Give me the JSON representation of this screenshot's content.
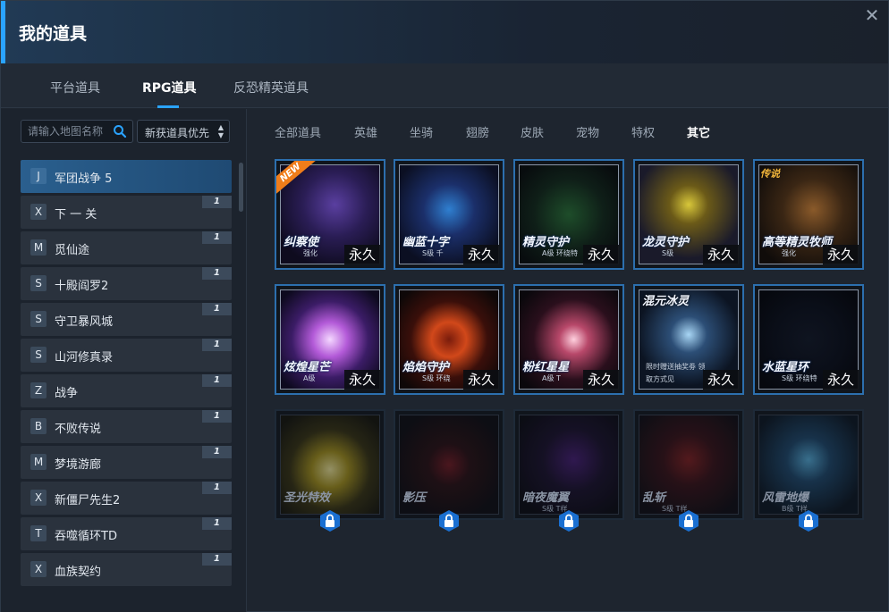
{
  "window": {
    "title": "我的道具",
    "close_icon": "close-icon"
  },
  "tabs": [
    {
      "label": "平台道具",
      "active": false
    },
    {
      "label": "RPG道具",
      "active": true
    },
    {
      "label": "反恐精英道具",
      "active": false
    }
  ],
  "sidebar": {
    "search": {
      "placeholder": "请输入地图名称",
      "value": "",
      "icon": "search-icon"
    },
    "sort": {
      "value": "新获道具优先",
      "icon": "sort-arrows-icon"
    },
    "items": [
      {
        "letter": "J",
        "name": "军团战争 5",
        "count": "",
        "active": true
      },
      {
        "letter": "X",
        "name": "下 一 关",
        "count": "1",
        "active": false
      },
      {
        "letter": "M",
        "name": "觅仙途",
        "count": "1",
        "active": false
      },
      {
        "letter": "S",
        "name": "十殿阎罗2",
        "count": "1",
        "active": false
      },
      {
        "letter": "S",
        "name": "守卫暴风城",
        "count": "1",
        "active": false
      },
      {
        "letter": "S",
        "name": "山河修真录",
        "count": "1",
        "active": false
      },
      {
        "letter": "Z",
        "name": "战争",
        "count": "1",
        "active": false
      },
      {
        "letter": "B",
        "name": "不败传说",
        "count": "1",
        "active": false
      },
      {
        "letter": "M",
        "name": "梦境游廊",
        "count": "1",
        "active": false
      },
      {
        "letter": "X",
        "name": "新僵尸先生2",
        "count": "1",
        "active": false
      },
      {
        "letter": "T",
        "name": "吞噬循环TD",
        "count": "1",
        "active": false
      },
      {
        "letter": "X",
        "name": "血族契约",
        "count": "1",
        "active": false
      }
    ]
  },
  "categories": [
    {
      "label": "全部道具",
      "active": false
    },
    {
      "label": "英雄",
      "active": false
    },
    {
      "label": "坐骑",
      "active": false
    },
    {
      "label": "翅膀",
      "active": false
    },
    {
      "label": "皮肤",
      "active": false
    },
    {
      "label": "宠物",
      "active": false
    },
    {
      "label": "特权",
      "active": false
    },
    {
      "label": "其它",
      "active": true
    }
  ],
  "items": [
    {
      "title": "纠察使",
      "subtitle": "强化",
      "badge": "永久",
      "new": true,
      "new_label": "NEW",
      "top_tag": "",
      "locked": false,
      "theme": "purple-wings"
    },
    {
      "title": "幽蓝十字",
      "subtitle": "S级 千",
      "badge": "永久",
      "new": false,
      "top_tag": "",
      "locked": false,
      "theme": "blue-cross"
    },
    {
      "title": "精灵守护",
      "subtitle": "A级 环绕特",
      "badge": "永久",
      "new": false,
      "top_tag": "",
      "locked": false,
      "theme": "green-sparkle"
    },
    {
      "title": "龙灵守护",
      "subtitle": "S级",
      "badge": "永久",
      "new": false,
      "top_tag": "",
      "locked": false,
      "theme": "gold-dragon"
    },
    {
      "title": "高等精灵牧师",
      "subtitle": "强化",
      "badge": "永久",
      "new": false,
      "top_tag": "传说",
      "locked": false,
      "theme": "priest"
    },
    {
      "title": "炫煌星芒",
      "subtitle": "A级",
      "badge": "永久",
      "new": false,
      "top_tag": "",
      "locked": false,
      "theme": "pink-orb"
    },
    {
      "title": "焰焰守护",
      "subtitle": "S级 环绕",
      "badge": "永久",
      "new": false,
      "top_tag": "",
      "locked": false,
      "theme": "fire-ring"
    },
    {
      "title": "粉红星星",
      "subtitle": "A级 T",
      "badge": "永久",
      "new": false,
      "top_tag": "",
      "locked": false,
      "theme": "pink-stars"
    },
    {
      "title": "",
      "subtitle": "限时赠送抽奖劵 领取方式见",
      "badge": "永久",
      "new": false,
      "top_tag": "混元冰灵",
      "locked": false,
      "theme": "ice-arc"
    },
    {
      "title": "水蓝星环",
      "subtitle": "S级 环绕特",
      "badge": "永久",
      "new": false,
      "top_tag": "",
      "locked": false,
      "theme": "cyan-ring"
    },
    {
      "title": "圣光特效",
      "subtitle": "",
      "badge": "",
      "new": false,
      "top_tag": "",
      "locked": true,
      "theme": "holy-light"
    },
    {
      "title": "影压",
      "subtitle": "",
      "badge": "",
      "new": false,
      "top_tag": "",
      "locked": true,
      "theme": "shadow"
    },
    {
      "title": "暗夜魔翼",
      "subtitle": "S级 T样",
      "badge": "",
      "new": false,
      "top_tag": "",
      "locked": true,
      "theme": "dark-wing"
    },
    {
      "title": "乱斩",
      "subtitle": "S级 T样",
      "badge": "",
      "new": false,
      "top_tag": "",
      "locked": true,
      "theme": "red-slash"
    },
    {
      "title": "风雷地爆",
      "subtitle": "B级 T样",
      "badge": "",
      "new": false,
      "top_tag": "",
      "locked": true,
      "theme": "blue-burst"
    }
  ],
  "colors": {
    "accent": "#2aa3ff",
    "card_border": "#2c6fae",
    "new_tag": "#f07d1a",
    "lock": "#1a6fd1"
  }
}
